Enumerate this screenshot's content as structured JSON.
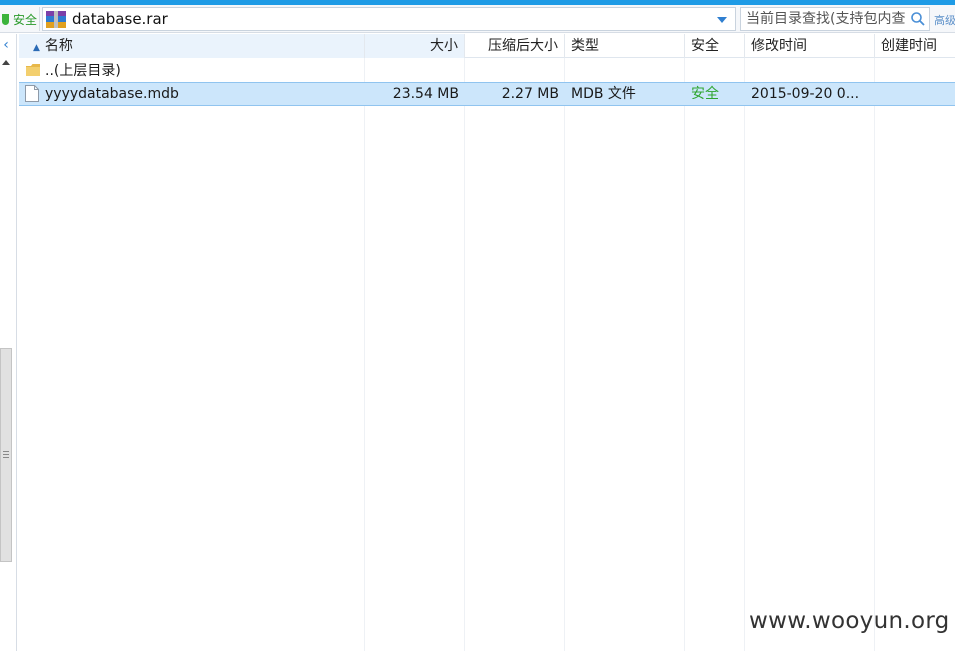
{
  "security": {
    "label": "安全"
  },
  "address": {
    "path": "database.rar"
  },
  "search": {
    "placeholder": "当前目录查找(支持包内查",
    "advanced_label": "高级"
  },
  "table": {
    "columns": [
      {
        "label": "名称"
      },
      {
        "label": "大小"
      },
      {
        "label": "压缩后大小"
      },
      {
        "label": "类型"
      },
      {
        "label": "安全"
      },
      {
        "label": "修改时间"
      },
      {
        "label": "创建时间"
      }
    ],
    "rows": [
      {
        "name": "..(上层目录)",
        "size": "",
        "packed": "",
        "type": "",
        "safety": "",
        "modified": "",
        "created": ""
      },
      {
        "name": "yyyydatabase.mdb",
        "size": "23.54 MB",
        "packed": "2.27 MB",
        "type": "MDB 文件",
        "safety": "安全",
        "modified": "2015-09-20 0...",
        "created": ""
      }
    ]
  },
  "watermark": "www.wooyun.org",
  "colors": {
    "accent": "#1e9be6",
    "safe": "#2fa52f",
    "selection": "#cce6fb"
  },
  "icons": {
    "parent_folder": "folder-icon",
    "mdb_file": "file-icon",
    "archive": "rar-archive-icon"
  }
}
